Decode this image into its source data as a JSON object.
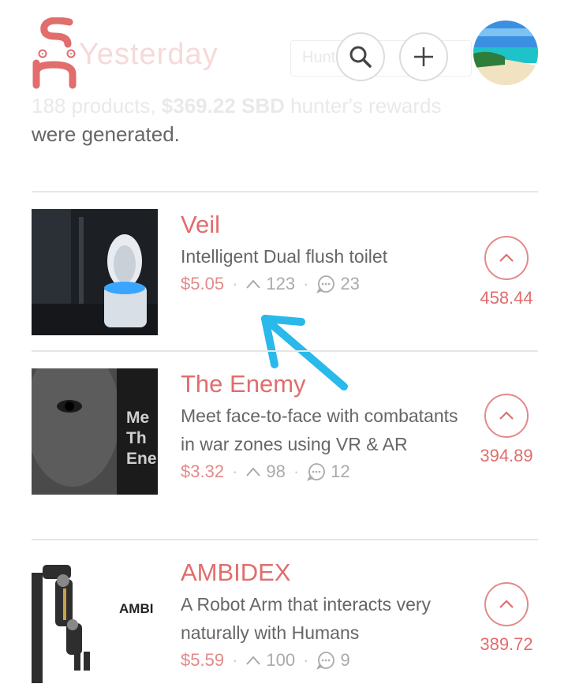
{
  "header": {
    "title_faded": "Yesterday",
    "search_placeholder": "Hunt here",
    "search_icon": "search-icon",
    "add_icon": "plus-icon"
  },
  "summary": {
    "products": "188 products,",
    "rewards": "$369.22 SBD",
    "rewards_suffix": " hunter's rewards",
    "generated": "were generated."
  },
  "colors": {
    "accent": "#e16d6d",
    "muted": "#aaaaaa",
    "divider": "#e6e6e6"
  },
  "posts": [
    {
      "title": "Veil",
      "tagline": "Intelligent Dual flush toilet",
      "price": "$5.05",
      "upvotes": "123",
      "comments": "23",
      "score": "458.44"
    },
    {
      "title": "The Enemy",
      "tagline": "Meet face-to-face with combatants in war zones using VR & AR",
      "price": "$3.32",
      "upvotes": "98",
      "comments": "12",
      "score": "394.89",
      "thumb_text": "Me\nTh\nEne"
    },
    {
      "title": "AMBIDEX",
      "tagline": "A Robot Arm that interacts very naturally with Humans",
      "price": "$5.59",
      "upvotes": "100",
      "comments": "9",
      "score": "389.72",
      "thumb_text": "AMBI"
    }
  ]
}
